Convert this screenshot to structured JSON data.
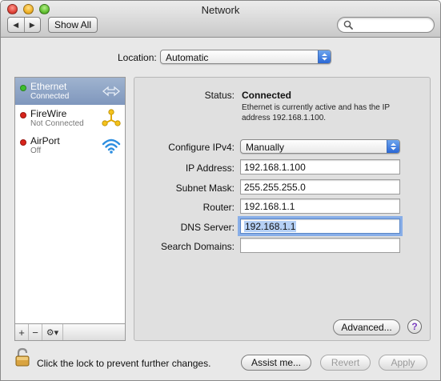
{
  "window": {
    "title": "Network"
  },
  "toolbar": {
    "back_glyph": "◀",
    "forward_glyph": "▶",
    "show_all_label": "Show All",
    "search_placeholder": ""
  },
  "location": {
    "label": "Location:",
    "value": "Automatic"
  },
  "services": [
    {
      "name": "Ethernet",
      "status": "Connected",
      "status_color": "#3dbf2e",
      "icon": "ethernet-arrows-icon",
      "selected": true
    },
    {
      "name": "FireWire",
      "status": "Not Connected",
      "status_color": "#d8231b",
      "icon": "firewire-icon",
      "selected": false
    },
    {
      "name": "AirPort",
      "status": "Off",
      "status_color": "#d8231b",
      "icon": "airport-wifi-icon",
      "selected": false
    }
  ],
  "sidebar_controls": {
    "add": "+",
    "remove": "−",
    "gear": "⚙▾"
  },
  "details": {
    "status_label": "Status:",
    "status_value": "Connected",
    "status_desc_line1": "Ethernet is currently active and has the IP",
    "status_desc_line2": "address 192.168.1.100.",
    "configure_label": "Configure IPv4:",
    "configure_value": "Manually",
    "ip_label": "IP Address:",
    "ip_value": "192.168.1.100",
    "subnet_label": "Subnet Mask:",
    "subnet_value": "255.255.255.0",
    "router_label": "Router:",
    "router_value": "192.168.1.1",
    "dns_label": "DNS Server:",
    "dns_value": "192.168.1.1",
    "search_domains_label": "Search Domains:",
    "search_domains_value": "",
    "advanced_label": "Advanced...",
    "help_label": "?"
  },
  "footer": {
    "lock_text": "Click the lock to prevent further changes.",
    "assist_label": "Assist me...",
    "revert_label": "Revert",
    "apply_label": "Apply"
  },
  "colors": {
    "accent": "#2a67d6",
    "selection": "#7f97bd",
    "focus_ring": "#88aee8"
  }
}
